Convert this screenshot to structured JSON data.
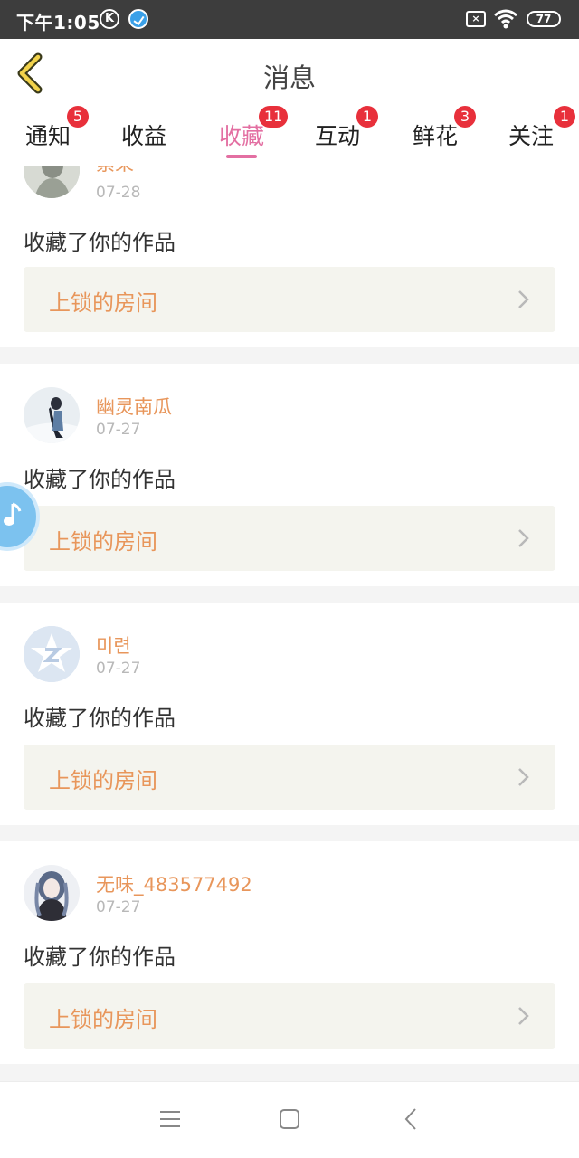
{
  "status_bar": {
    "time": "下午1:05",
    "k_icon_label": "K",
    "sim_label": "×",
    "battery": "77"
  },
  "header": {
    "title": "消息",
    "back_icon": "chevron-left-icon"
  },
  "tabs": [
    {
      "label": "通知",
      "badge": "5",
      "active": false
    },
    {
      "label": "收益",
      "badge": "",
      "active": false
    },
    {
      "label": "收藏",
      "badge": "11",
      "active": true
    },
    {
      "label": "互动",
      "badge": "1",
      "active": false
    },
    {
      "label": "鲜花",
      "badge": "3",
      "active": false
    },
    {
      "label": "关注",
      "badge": "1",
      "active": false
    }
  ],
  "messages": [
    {
      "username": "素果",
      "date": "07-28",
      "action": "收藏了你的作品",
      "work_title": "上锁的房间"
    },
    {
      "username": "幽灵南瓜",
      "date": "07-27",
      "action": "收藏了你的作品",
      "work_title": "上锁的房间"
    },
    {
      "username": "미련",
      "date": "07-27",
      "action": "收藏了你的作品",
      "work_title": "上锁的房间"
    },
    {
      "username": "无味_483577492",
      "date": "07-27",
      "action": "收藏了你的作品",
      "work_title": "上锁的房间"
    }
  ],
  "colors": {
    "accent_pink": "#e36fa2",
    "username_orange": "#e8965b",
    "badge_red": "#e8303b"
  }
}
